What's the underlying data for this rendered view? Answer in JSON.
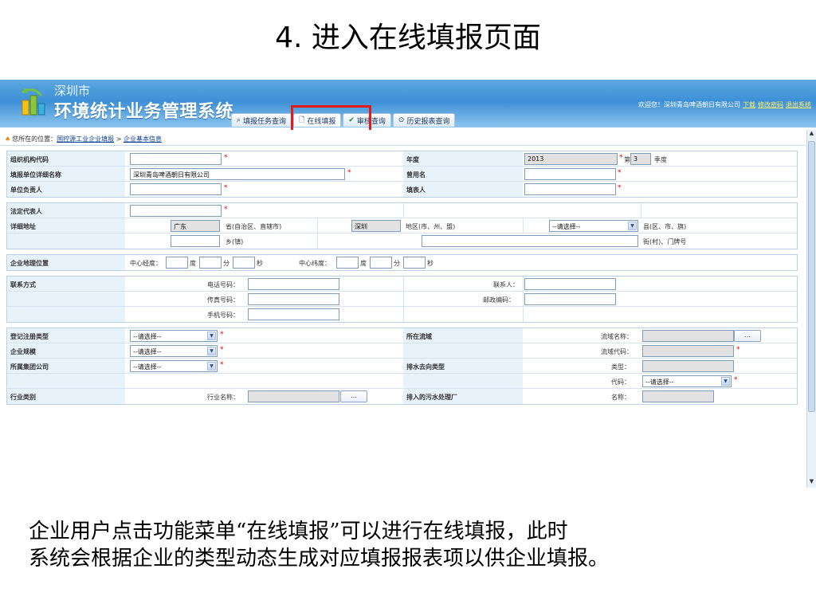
{
  "slide": {
    "title": "4. 进入在线填报页面",
    "caption_line1": "企业用户点击功能菜单“在线填报”可以进行在线填报，此时",
    "caption_line2": "系统会根据企业的类型动态生成对应填报报表项以供企业填报。"
  },
  "header": {
    "city": "深圳市",
    "system_name": "环境统计业务管理系统",
    "welcome": "欢迎您！深圳青岛啤酒朝日有限公司",
    "links": [
      "下载",
      "修改密码",
      "退出系统"
    ]
  },
  "nav": {
    "tabs": [
      {
        "label": "填报任务查询",
        "icon": "search-icon"
      },
      {
        "label": "在线填报",
        "icon": "document-icon",
        "active": true
      },
      {
        "label": "审核查询",
        "icon": "check-icon"
      },
      {
        "label": "历史报表查询",
        "icon": "history-icon"
      }
    ]
  },
  "breadcrumb": {
    "prefix": "您所在的位置：",
    "item1": "国控源工业企业填报",
    "sep": " > ",
    "item2": "企业基本信息"
  },
  "form": {
    "org_code_label": "组织机构代码",
    "year_label": "年度",
    "year_value": "2013",
    "quarter_prefix": "第",
    "quarter_value": "3",
    "quarter_suffix": "季度",
    "unit_name_label": "填报单位详细名称",
    "unit_name_value": "深圳青岛啤酒朝日有限公司",
    "former_name_label": "曾用名",
    "unit_head_label": "单位负责人",
    "filler_label": "填表人",
    "legal_rep_label": "法定代表人",
    "address_label": "详细地址",
    "province_value": "广东",
    "province_suffix": "省(自治区、直辖市)",
    "city_value": "深圳",
    "city_suffix": "地区(市、州、盟)",
    "county_select": "--请选择--",
    "county_suffix": "县(区、市、旗)",
    "town_suffix": "乡(镇)",
    "street_suffix": "街(村)、门牌号",
    "geo_label": "企业地理位置",
    "lon_label": "中心经度：",
    "lat_label": "中心纬度：",
    "deg": "度",
    "min": "分",
    "sec": "秒",
    "contact_label": "联系方式",
    "phone_label": "电话号码：",
    "fax_label": "传真号码：",
    "mobile_label": "手机号码：",
    "contact_person_label": "联系人：",
    "postcode_label": "邮政编码：",
    "reg_type_label": "登记注册类型",
    "reg_type_value": "--请选择--",
    "basin_label": "所在流域",
    "basin_name_label": "流域名称：",
    "scale_label": "企业规模",
    "scale_value": "--请选择--",
    "basin_code_label": "流域代码：",
    "group_label": "所属集团公司",
    "group_value": "--请选择--",
    "drain_label": "排水去向类型",
    "type_label": "类型：",
    "code_label": "代码：",
    "code_select": "--请选择--",
    "industry_label": "行业类别",
    "industry_name_label": "行业名称：",
    "sewage_label": "排入的污水处理厂",
    "name_label": "名称：",
    "ellipsis": "…"
  }
}
